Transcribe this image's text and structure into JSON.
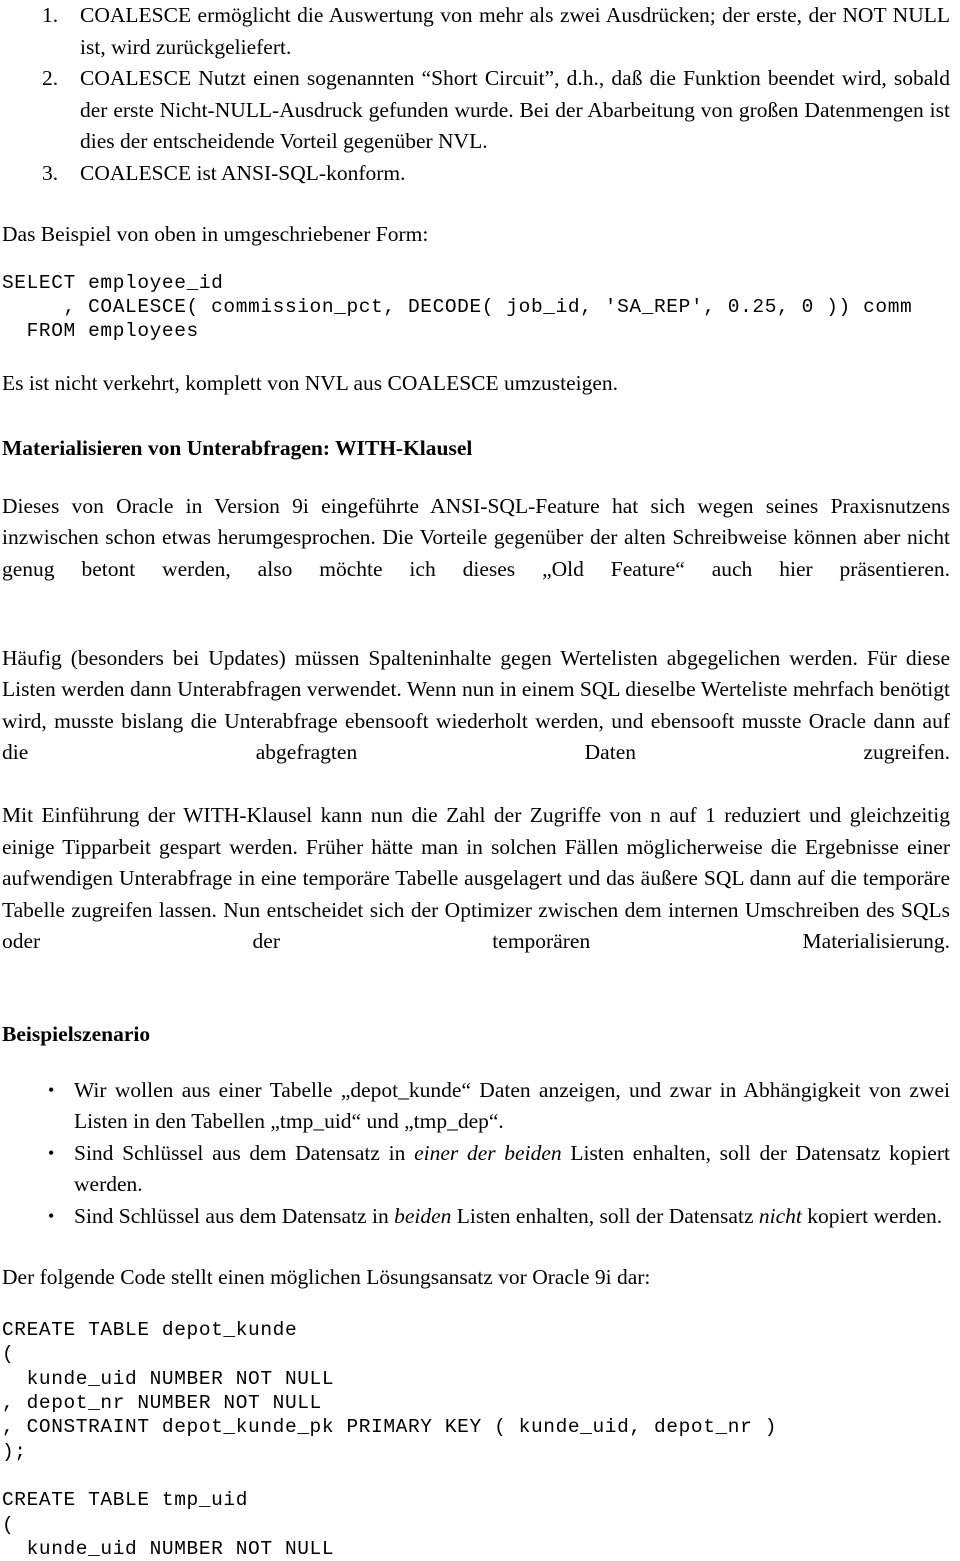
{
  "document": {
    "numbered_list": [
      {
        "marker": "1.",
        "text": "COALESCE ermöglicht die Auswertung von mehr als zwei Ausdrücken; der erste, der NOT NULL ist, wird zurückgeliefert."
      },
      {
        "marker": "2.",
        "text": "COALESCE Nutzt einen sogenannten “Short Circuit”, d.h., daß die Funktion beendet wird, sobald der erste Nicht-NULL-Ausdruck gefunden wurde. Bei der Abarbeitung von großen Datenmengen ist dies der entscheidende Vorteil gegenüber NVL."
      },
      {
        "marker": "3.",
        "text": "COALESCE ist ANSI-SQL-konform."
      }
    ],
    "intro_example_label": "Das Beispiel von oben in umgeschriebener Form:",
    "code_block_1": "SELECT employee_id\n     , COALESCE( commission_pct, DECODE( job_id, 'SA_REP', 0.25, 0 )) comm\n  FROM employees",
    "after_code_1": "Es ist nicht verkehrt, komplett von NVL aus COALESCE umzusteigen.",
    "heading_with": "Materialisieren von Unterabfragen: WITH-Klausel",
    "para_intro": "Dieses von Oracle in Version 9i eingeführte ANSI-SQL-Feature hat sich wegen seines Praxisnutzens inzwischen schon etwas herumgesprochen. Die Vorteile gegenüber der alten Schreibweise können aber nicht genug betont werden, also möchte ich dieses „Old Feature“ auch hier präsentieren.",
    "para_body_1": "Häufig (besonders bei Updates) müssen Spalteninhalte gegen Wertelisten abgegelichen werden. Für diese Listen werden dann Unterabfragen verwendet. Wenn nun in einem SQL dieselbe Werteliste mehrfach benötigt wird, musste bislang die Unterabfrage ebensooft wiederholt werden, und ebensooft musste Oracle dann auf die abgefragten Daten zugreifen.",
    "para_body_2": "Mit Einführung der WITH-Klausel kann nun die Zahl der Zugriffe von n auf 1 reduziert und gleichzeitig einige Tipparbeit gespart werden. Früher hätte man in solchen Fällen möglicherweise die Ergebnisse einer aufwendigen Unterabfrage in eine temporäre Tabelle ausgelagert und das äußere SQL dann auf die temporäre Tabelle zugreifen lassen. Nun entscheidet sich der Optimizer zwischen dem internen Umschreiben des SQLs oder der temporären Materialisierung.",
    "heading_scenario": "Beispielszenario",
    "bullets": [
      {
        "bullet_glyph": "•",
        "parts": [
          {
            "text": "Wir wollen aus einer Tabelle „depot_kunde“ Daten anzeigen, und zwar in Abhängigkeit von zwei Listen in den Tabellen „tmp_uid“ und „tmp_dep“.",
            "style": "normal"
          }
        ]
      },
      {
        "bullet_glyph": "•",
        "parts": [
          {
            "text": "Sind Schlüssel aus dem Datensatz in ",
            "style": "normal"
          },
          {
            "text": "einer der beiden",
            "style": "italic"
          },
          {
            "text": " Listen enhalten, soll der Datensatz kopiert werden.",
            "style": "normal"
          }
        ]
      },
      {
        "bullet_glyph": "•",
        "parts": [
          {
            "text": "Sind Schlüssel aus dem Datensatz in ",
            "style": "normal"
          },
          {
            "text": "beiden",
            "style": "italic"
          },
          {
            "text": " Listen enhalten, soll der Datensatz ",
            "style": "normal"
          },
          {
            "text": "nicht",
            "style": "italic"
          },
          {
            "text": " kopiert werden.",
            "style": "normal"
          }
        ]
      }
    ],
    "para_code_intro": "Der folgende Code stellt einen möglichen Lösungsansatz vor Oracle 9i dar:",
    "code_block_2": "CREATE TABLE depot_kunde\n(\n  kunde_uid NUMBER NOT NULL\n, depot_nr NUMBER NOT NULL\n, CONSTRAINT depot_kunde_pk PRIMARY KEY ( kunde_uid, depot_nr )\n);",
    "code_block_3": "CREATE TABLE tmp_uid\n(\n  kunde_uid NUMBER NOT NULL"
  }
}
